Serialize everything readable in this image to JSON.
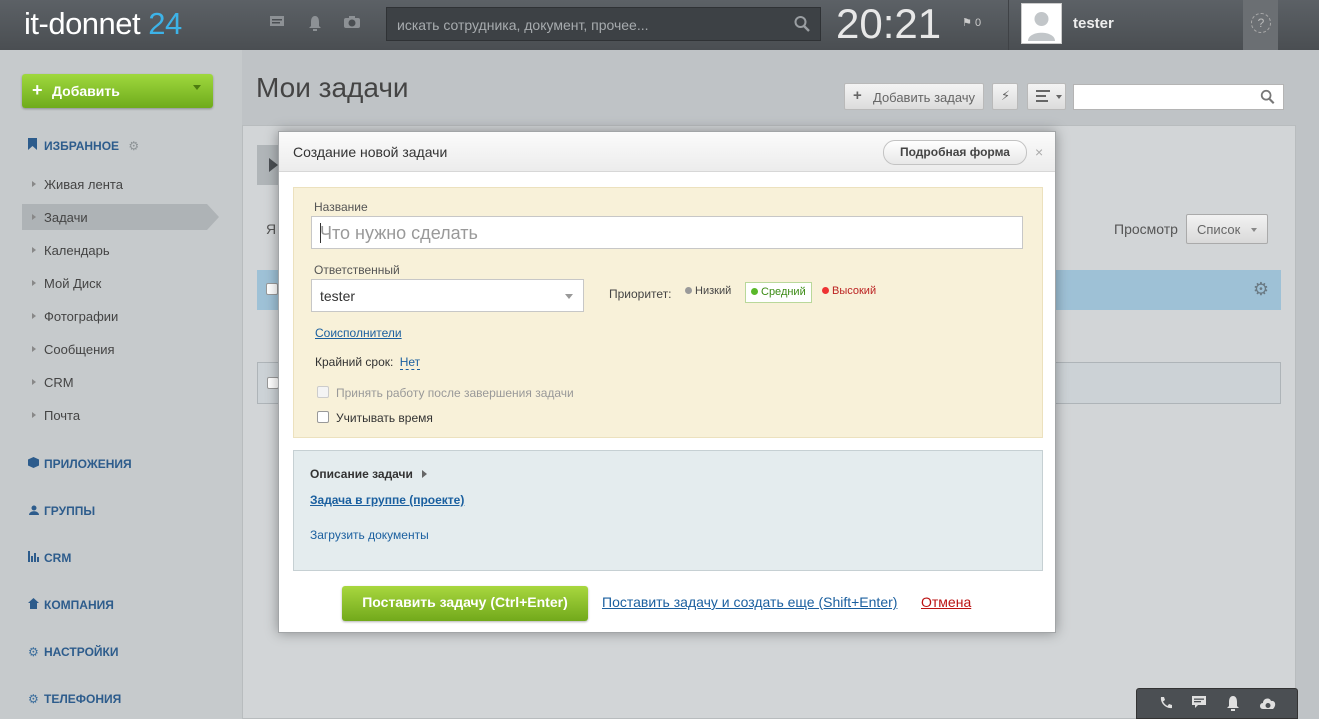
{
  "header": {
    "logo_text": "it-donnet",
    "logo_num": "24",
    "search_placeholder": "искать сотрудника, документ, прочее...",
    "time": "20:21",
    "flag_count": "0",
    "username": "tester",
    "help": "?"
  },
  "sidebar": {
    "add_label": "Добавить",
    "favorites": "ИЗБРАННОЕ",
    "items": [
      "Живая лента",
      "Задачи",
      "Календарь",
      "Мой Диск",
      "Фотографии",
      "Сообщения",
      "CRM",
      "Почта"
    ],
    "sections": [
      "ПРИЛОЖЕНИЯ",
      "ГРУППЫ",
      "CRM",
      "КОМПАНИЯ",
      "НАСТРОЙКИ",
      "ТЕЛЕФОНИЯ"
    ]
  },
  "main": {
    "title": "Мои задачи",
    "add_task": "Добавить задачу",
    "view_label": "Просмотр",
    "view_value": "Список",
    "bg_letter": "Я"
  },
  "dialog": {
    "title": "Создание новой задачи",
    "full_form": "Подробная форма",
    "close": "×",
    "name_label": "Название",
    "name_placeholder": "Что нужно сделать",
    "responsible_label": "Ответственный",
    "responsible_value": "tester",
    "priority_label": "Приоритет:",
    "priority_low": "Низкий",
    "priority_mid": "Средний",
    "priority_high": "Высокий",
    "coexecutors": "Соисполнители",
    "deadline_label": "Крайний срок:",
    "deadline_value": "Нет",
    "accept_work": "Принять работу после завершения задачи",
    "track_time": "Учитывать время",
    "description": "Описание задачи",
    "group_task": "Задача в группе (проекте)",
    "upload_docs": "Загрузить документы",
    "submit": "Поставить задачу (Ctrl+Enter)",
    "submit_more": "Поставить задачу и создать еще (Shift+Enter)",
    "cancel": "Отмена"
  },
  "colors": {
    "accent_green": "#7db62a",
    "link_blue": "#1a5f9f",
    "cancel_red": "#b11111"
  }
}
